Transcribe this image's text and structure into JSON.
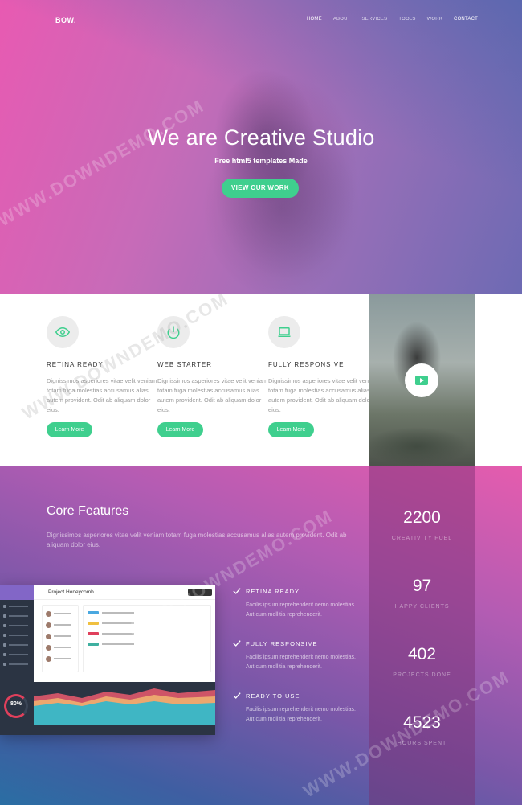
{
  "brand": {
    "logo": "BOW."
  },
  "nav": {
    "items": [
      {
        "label": "HOME"
      },
      {
        "label": "ABOUT"
      },
      {
        "label": "SERVICES"
      },
      {
        "label": "TOOLS"
      },
      {
        "label": "WORK"
      },
      {
        "label": "CONTACT"
      }
    ]
  },
  "hero": {
    "title": "We are Creative Studio",
    "subtitle": "Free html5 templates Made",
    "cta": "VIEW OUR WORK"
  },
  "features": [
    {
      "icon": "eye-icon",
      "title": "RETINA READY",
      "text": "Dignissimos asperiores vitae velit veniam totam fuga molestias accusamus alias autem provident. Odit ab aliquam dolor eius.",
      "button": "Learn More"
    },
    {
      "icon": "power-icon",
      "title": "WEB STARTER",
      "text": "Dignissimos asperiores vitae velit veniam totam fuga molestias accusamus alias autem provident. Odit ab aliquam dolor eius.",
      "button": "Learn More"
    },
    {
      "icon": "laptop-icon",
      "title": "FULLY RESPONSIVE",
      "text": "Dignissimos asperiores vitae velit veniam totam fuga molestias accusamus alias autem provident. Odit ab aliquam dolor eius.",
      "button": "Learn More"
    }
  ],
  "core": {
    "title": "Core Features",
    "description": "Dignissimos asperiores vitae velit veniam totam fuga molestias accusamus alias autem provident. Odit ab aliquam dolor eius.",
    "items": [
      {
        "title": "RETINA READY",
        "text": "Facilis ipsum reprehenderit nemo molestias. Aut cum mollitia reprehenderit."
      },
      {
        "title": "FULLY RESPONSIVE",
        "text": "Facilis ipsum reprehenderit nemo molestias. Aut cum mollitia reprehenderit."
      },
      {
        "title": "READY TO USE",
        "text": "Facilis ipsum reprehenderit nemo molestias. Aut cum mollitia reprehenderit."
      }
    ]
  },
  "dashboard": {
    "project_title": "Project Honeycomb",
    "progress": "80%"
  },
  "stats": [
    {
      "value": "2200",
      "label": "CREATIVITY FUEL"
    },
    {
      "value": "97",
      "label": "HAPPY CLIENTS"
    },
    {
      "value": "402",
      "label": "PROJECTS DONE"
    },
    {
      "value": "4523",
      "label": "HOURS SPENT"
    }
  ],
  "watermark": "WWW.DOWNDEMO.COM",
  "colors": {
    "accent": "#3fcf8e",
    "hero_pink": "#e85ab2",
    "hero_purple": "#6d6ab3"
  }
}
